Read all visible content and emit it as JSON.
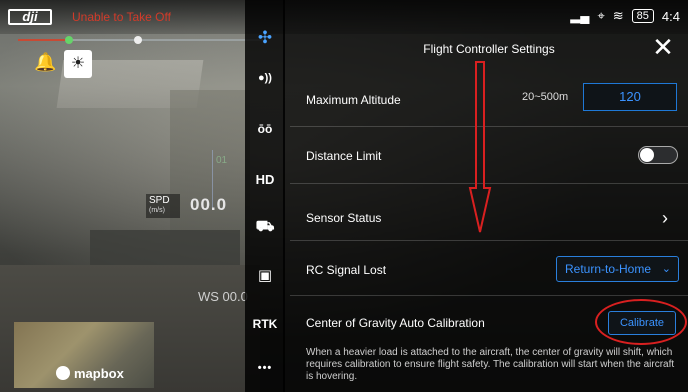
{
  "camera": {
    "status_text": "Unable to Take Off",
    "spd_label": "SPD",
    "spd_unit": "(m/s)",
    "spd_value": "00.0",
    "ws_value": "WS 00.0",
    "hud_small": "01",
    "map_brand": "mapbox"
  },
  "topbar": {
    "battery": "85",
    "time": "4:4"
  },
  "icon_column": {
    "items": [
      {
        "name": "drone-icon",
        "glyph": "✣"
      },
      {
        "name": "signal-icon",
        "glyph": "●))"
      },
      {
        "name": "remote-controller-icon",
        "glyph": "ōō"
      },
      {
        "name": "hd-label",
        "glyph": "HD"
      },
      {
        "name": "payload-icon",
        "glyph": "⛟"
      },
      {
        "name": "battery-icon",
        "glyph": "▣"
      },
      {
        "name": "rtk-label",
        "glyph": "RTK"
      },
      {
        "name": "more-icon",
        "glyph": "•••"
      }
    ]
  },
  "panel": {
    "title": "Flight Controller Settings",
    "close_glyph": "✕",
    "max_altitude": {
      "label": "Maximum Altitude",
      "range": "20~500m",
      "value": "120"
    },
    "distance_limit": {
      "label": "Distance Limit",
      "enabled": false
    },
    "sensor_status": {
      "label": "Sensor Status"
    },
    "rc_signal_lost": {
      "label": "RC Signal Lost",
      "selected": "Return-to-Home"
    },
    "cog_calibration": {
      "label": "Center of Gravity Auto Calibration",
      "button": "Calibrate",
      "description": "When a heavier load is attached to the aircraft, the center of gravity will shift, which requires calibration to ensure flight safety. The calibration will start when the aircraft is hovering."
    }
  },
  "colors": {
    "accent_blue": "#2a7fdc",
    "annotation_red": "#d92020"
  }
}
